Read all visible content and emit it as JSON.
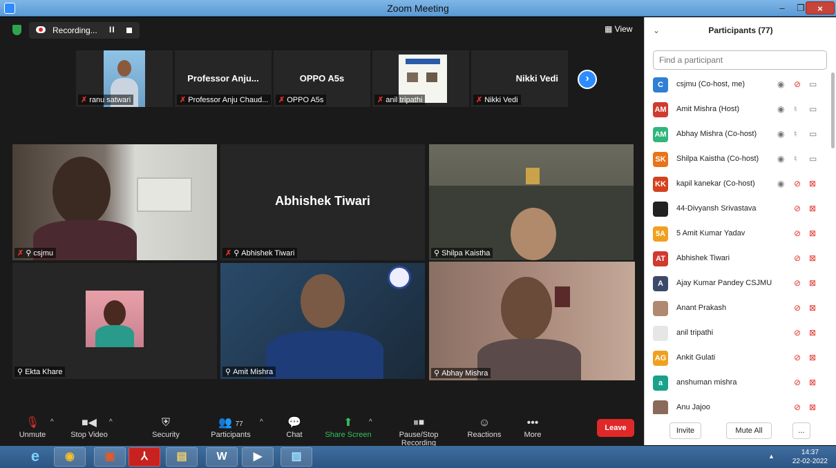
{
  "window": {
    "title": "Zoom Meeting",
    "minimize": "–",
    "restore": "❐",
    "close": "×"
  },
  "recording": {
    "label": "Recording...",
    "pause": "II"
  },
  "view_label": "View",
  "strip": [
    {
      "name": "ranu satwari",
      "big": "",
      "muted": true
    },
    {
      "name": "Professor Anju Chaud...",
      "big": "Professor Anju...",
      "muted": true
    },
    {
      "name": "OPPO A5s",
      "big": "OPPO A5s",
      "muted": true
    },
    {
      "name": "anil tripathi",
      "big": "",
      "muted": true
    },
    {
      "name": "Nikki Vedi",
      "big": "Nikki Vedi",
      "muted": true
    }
  ],
  "gallery": [
    {
      "name": "csjmu",
      "big": ""
    },
    {
      "name": "Abhishek Tiwari",
      "big": "Abhishek Tiwari"
    },
    {
      "name": "Shilpa Kaistha",
      "big": ""
    },
    {
      "name": "Ekta Khare",
      "big": ""
    },
    {
      "name": "Amit Mishra",
      "big": ""
    },
    {
      "name": "Abhay Mishra",
      "big": ""
    }
  ],
  "toolbar": {
    "unmute": "Unmute",
    "stop_video": "Stop Video",
    "security": "Security",
    "participants": "Participants",
    "participants_count": "77",
    "chat": "Chat",
    "share_screen": "Share Screen",
    "pause_stop_recording": "Pause/Stop Recording",
    "reactions": "Reactions",
    "more": "More",
    "leave": "Leave"
  },
  "panel": {
    "title": "Participants (77)",
    "search_placeholder": "Find a participant",
    "invite": "Invite",
    "mute_all": "Mute All",
    "more": "..."
  },
  "participants": [
    {
      "initials": "C",
      "color": "#2f7fd4",
      "name": "csjmu (Co-host, me)",
      "mic": "muted",
      "cam": "on",
      "share": true
    },
    {
      "initials": "AM",
      "color": "#d13a2f",
      "name": "Amit Mishra (Host)",
      "mic": "on",
      "cam": "on",
      "share": true
    },
    {
      "initials": "AM",
      "color": "#2eb67d",
      "name": "Abhay Mishra (Co-host)",
      "mic": "on",
      "cam": "on",
      "share": true
    },
    {
      "initials": "SK",
      "color": "#e8731a",
      "name": "Shilpa Kaistha (Co-host)",
      "mic": "on",
      "cam": "on",
      "share": true
    },
    {
      "initials": "KK",
      "color": "#d4421f",
      "name": "kapil kanekar (Co-host)",
      "mic": "muted",
      "cam": "off",
      "share": true
    },
    {
      "initials": "",
      "color": "#222222",
      "name": "44-Divyansh Srivastava",
      "mic": "muted",
      "cam": "off",
      "share": false
    },
    {
      "initials": "5A",
      "color": "#f0a020",
      "name": "5 Amit Kumar Yadav",
      "mic": "muted",
      "cam": "off",
      "share": false
    },
    {
      "initials": "AT",
      "color": "#d13a2f",
      "name": "Abhishek Tiwari",
      "mic": "muted",
      "cam": "off",
      "share": false
    },
    {
      "initials": "A",
      "color": "#3b4a6b",
      "name": "Ajay Kumar Pandey CSJMU",
      "mic": "muted",
      "cam": "off",
      "share": false
    },
    {
      "initials": "",
      "color": "#b08a70",
      "name": "Anant Prakash",
      "mic": "muted",
      "cam": "off",
      "share": false
    },
    {
      "initials": "",
      "color": "#e6e6e6",
      "name": "anil tripathi",
      "mic": "muted",
      "cam": "off",
      "share": false
    },
    {
      "initials": "AG",
      "color": "#f0a020",
      "name": "Ankit Gulati",
      "mic": "muted",
      "cam": "off",
      "share": false
    },
    {
      "initials": "a",
      "color": "#18a28a",
      "name": "anshuman mishra",
      "mic": "muted",
      "cam": "off",
      "share": false
    },
    {
      "initials": "",
      "color": "#8a6a5a",
      "name": "Anu Jajoo",
      "mic": "muted",
      "cam": "off",
      "share": false
    }
  ],
  "taskbar": {
    "time": "14:37",
    "date": "22-02-2022"
  }
}
